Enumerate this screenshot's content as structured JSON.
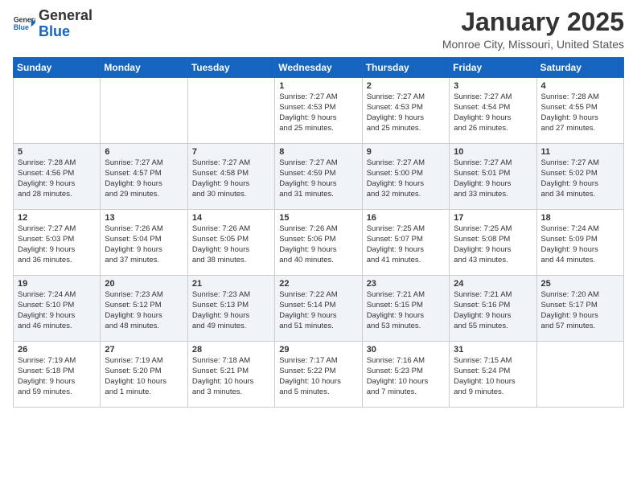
{
  "header": {
    "logo_general": "General",
    "logo_blue": "Blue",
    "month_title": "January 2025",
    "location": "Monroe City, Missouri, United States"
  },
  "weekdays": [
    "Sunday",
    "Monday",
    "Tuesday",
    "Wednesday",
    "Thursday",
    "Friday",
    "Saturday"
  ],
  "weeks": [
    [
      {
        "day": "",
        "info": ""
      },
      {
        "day": "",
        "info": ""
      },
      {
        "day": "",
        "info": ""
      },
      {
        "day": "1",
        "info": "Sunrise: 7:27 AM\nSunset: 4:53 PM\nDaylight: 9 hours\nand 25 minutes."
      },
      {
        "day": "2",
        "info": "Sunrise: 7:27 AM\nSunset: 4:53 PM\nDaylight: 9 hours\nand 25 minutes."
      },
      {
        "day": "3",
        "info": "Sunrise: 7:27 AM\nSunset: 4:54 PM\nDaylight: 9 hours\nand 26 minutes."
      },
      {
        "day": "4",
        "info": "Sunrise: 7:28 AM\nSunset: 4:55 PM\nDaylight: 9 hours\nand 27 minutes."
      }
    ],
    [
      {
        "day": "5",
        "info": "Sunrise: 7:28 AM\nSunset: 4:56 PM\nDaylight: 9 hours\nand 28 minutes."
      },
      {
        "day": "6",
        "info": "Sunrise: 7:27 AM\nSunset: 4:57 PM\nDaylight: 9 hours\nand 29 minutes."
      },
      {
        "day": "7",
        "info": "Sunrise: 7:27 AM\nSunset: 4:58 PM\nDaylight: 9 hours\nand 30 minutes."
      },
      {
        "day": "8",
        "info": "Sunrise: 7:27 AM\nSunset: 4:59 PM\nDaylight: 9 hours\nand 31 minutes."
      },
      {
        "day": "9",
        "info": "Sunrise: 7:27 AM\nSunset: 5:00 PM\nDaylight: 9 hours\nand 32 minutes."
      },
      {
        "day": "10",
        "info": "Sunrise: 7:27 AM\nSunset: 5:01 PM\nDaylight: 9 hours\nand 33 minutes."
      },
      {
        "day": "11",
        "info": "Sunrise: 7:27 AM\nSunset: 5:02 PM\nDaylight: 9 hours\nand 34 minutes."
      }
    ],
    [
      {
        "day": "12",
        "info": "Sunrise: 7:27 AM\nSunset: 5:03 PM\nDaylight: 9 hours\nand 36 minutes."
      },
      {
        "day": "13",
        "info": "Sunrise: 7:26 AM\nSunset: 5:04 PM\nDaylight: 9 hours\nand 37 minutes."
      },
      {
        "day": "14",
        "info": "Sunrise: 7:26 AM\nSunset: 5:05 PM\nDaylight: 9 hours\nand 38 minutes."
      },
      {
        "day": "15",
        "info": "Sunrise: 7:26 AM\nSunset: 5:06 PM\nDaylight: 9 hours\nand 40 minutes."
      },
      {
        "day": "16",
        "info": "Sunrise: 7:25 AM\nSunset: 5:07 PM\nDaylight: 9 hours\nand 41 minutes."
      },
      {
        "day": "17",
        "info": "Sunrise: 7:25 AM\nSunset: 5:08 PM\nDaylight: 9 hours\nand 43 minutes."
      },
      {
        "day": "18",
        "info": "Sunrise: 7:24 AM\nSunset: 5:09 PM\nDaylight: 9 hours\nand 44 minutes."
      }
    ],
    [
      {
        "day": "19",
        "info": "Sunrise: 7:24 AM\nSunset: 5:10 PM\nDaylight: 9 hours\nand 46 minutes."
      },
      {
        "day": "20",
        "info": "Sunrise: 7:23 AM\nSunset: 5:12 PM\nDaylight: 9 hours\nand 48 minutes."
      },
      {
        "day": "21",
        "info": "Sunrise: 7:23 AM\nSunset: 5:13 PM\nDaylight: 9 hours\nand 49 minutes."
      },
      {
        "day": "22",
        "info": "Sunrise: 7:22 AM\nSunset: 5:14 PM\nDaylight: 9 hours\nand 51 minutes."
      },
      {
        "day": "23",
        "info": "Sunrise: 7:21 AM\nSunset: 5:15 PM\nDaylight: 9 hours\nand 53 minutes."
      },
      {
        "day": "24",
        "info": "Sunrise: 7:21 AM\nSunset: 5:16 PM\nDaylight: 9 hours\nand 55 minutes."
      },
      {
        "day": "25",
        "info": "Sunrise: 7:20 AM\nSunset: 5:17 PM\nDaylight: 9 hours\nand 57 minutes."
      }
    ],
    [
      {
        "day": "26",
        "info": "Sunrise: 7:19 AM\nSunset: 5:18 PM\nDaylight: 9 hours\nand 59 minutes."
      },
      {
        "day": "27",
        "info": "Sunrise: 7:19 AM\nSunset: 5:20 PM\nDaylight: 10 hours\nand 1 minute."
      },
      {
        "day": "28",
        "info": "Sunrise: 7:18 AM\nSunset: 5:21 PM\nDaylight: 10 hours\nand 3 minutes."
      },
      {
        "day": "29",
        "info": "Sunrise: 7:17 AM\nSunset: 5:22 PM\nDaylight: 10 hours\nand 5 minutes."
      },
      {
        "day": "30",
        "info": "Sunrise: 7:16 AM\nSunset: 5:23 PM\nDaylight: 10 hours\nand 7 minutes."
      },
      {
        "day": "31",
        "info": "Sunrise: 7:15 AM\nSunset: 5:24 PM\nDaylight: 10 hours\nand 9 minutes."
      },
      {
        "day": "",
        "info": ""
      }
    ]
  ]
}
